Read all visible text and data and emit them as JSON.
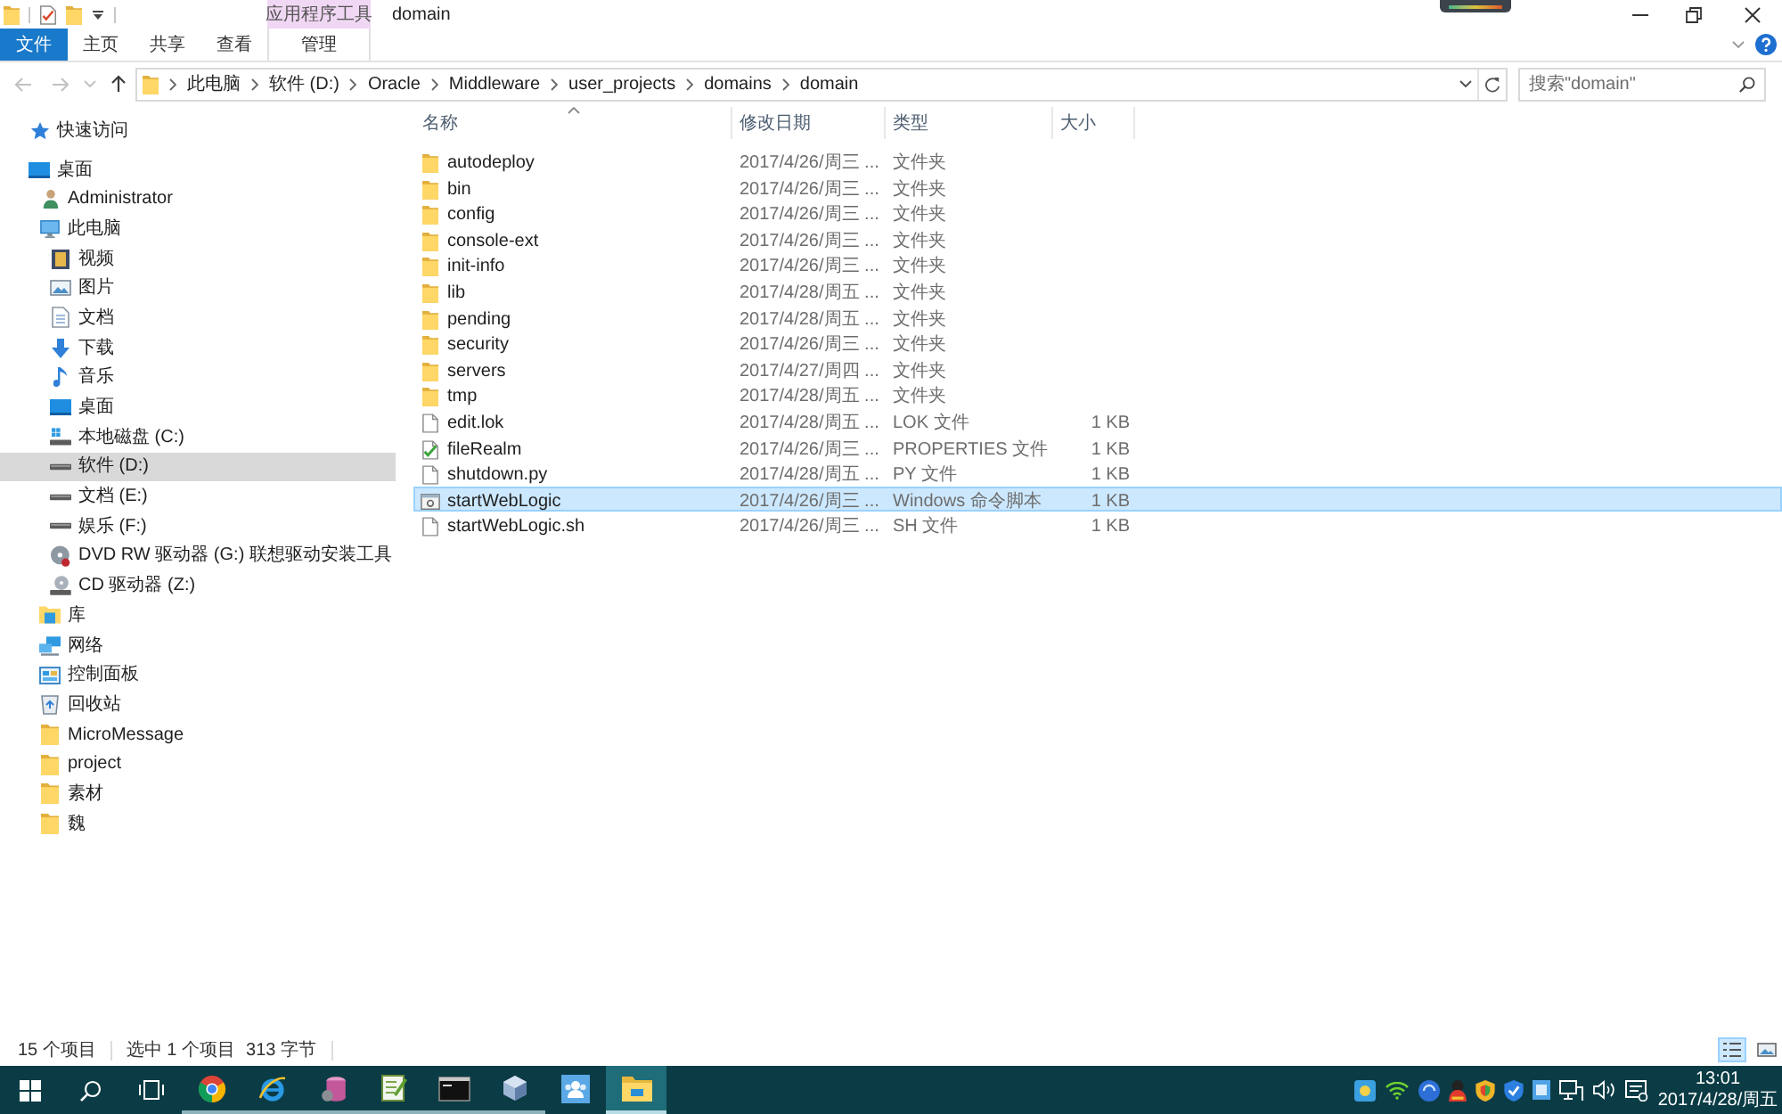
{
  "title_bar": {
    "title": "domain"
  },
  "ribbon": {
    "context_group": "应用程序工具",
    "tabs": [
      {
        "label": "文件",
        "kind": "file"
      },
      {
        "label": "主页",
        "kind": "standard"
      },
      {
        "label": "共享",
        "kind": "standard"
      },
      {
        "label": "查看",
        "kind": "standard"
      },
      {
        "label": "管理",
        "kind": "contextual"
      }
    ]
  },
  "navigation": [
    {
      "kind": "back",
      "disabled": true
    },
    {
      "kind": "forward",
      "disabled": true
    },
    {
      "kind": "recent",
      "disabled": true
    },
    {
      "kind": "up",
      "disabled": false
    }
  ],
  "address_bar": {
    "breadcrumbs": [
      "此电脑",
      "软件 (D:)",
      "Oracle",
      "Middleware",
      "user_projects",
      "domains",
      "domain"
    ]
  },
  "search": {
    "placeholder": "搜索\"domain\""
  },
  "sidebar": {
    "items": [
      {
        "label": "快速访问",
        "kind": "star",
        "selected": false
      },
      {
        "label": "桌面",
        "kind": "desktop",
        "selected": false,
        "children": [
          {
            "label": "Administrator",
            "kind": "user",
            "selected": false
          },
          {
            "label": "此电脑",
            "kind": "pc",
            "selected": false,
            "children": [
              {
                "label": "视频",
                "kind": "video",
                "selected": false
              },
              {
                "label": "图片",
                "kind": "picture",
                "selected": false
              },
              {
                "label": "文档",
                "kind": "document",
                "selected": false
              },
              {
                "label": "下载",
                "kind": "download",
                "selected": false
              },
              {
                "label": "音乐",
                "kind": "music",
                "selected": false
              },
              {
                "label": "桌面",
                "kind": "desktop",
                "selected": false
              },
              {
                "label": "本地磁盘 (C:)",
                "kind": "system-drive",
                "selected": false
              },
              {
                "label": "软件 (D:)",
                "kind": "drive",
                "selected": true
              },
              {
                "label": "文档 (E:)",
                "kind": "drive",
                "selected": false
              },
              {
                "label": "娱乐 (F:)",
                "kind": "drive",
                "selected": false
              },
              {
                "label": "DVD RW 驱动器 (G:) 联想驱动安装工具",
                "kind": "dvd",
                "selected": false
              },
              {
                "label": "CD 驱动器 (Z:)",
                "kind": "cd",
                "selected": false
              }
            ]
          },
          {
            "label": "库",
            "kind": "library",
            "selected": false
          },
          {
            "label": "网络",
            "kind": "network",
            "selected": false
          },
          {
            "label": "控制面板",
            "kind": "control-panel",
            "selected": false
          },
          {
            "label": "回收站",
            "kind": "recycle-bin",
            "selected": false
          },
          {
            "label": "MicroMessage",
            "kind": "folder",
            "selected": false
          },
          {
            "label": "project",
            "kind": "folder",
            "selected": false
          },
          {
            "label": "素材",
            "kind": "folder",
            "selected": false
          },
          {
            "label": "魏",
            "kind": "folder",
            "selected": false
          }
        ]
      }
    ]
  },
  "files": {
    "columns": [
      {
        "label": "名称",
        "sorted": true
      },
      {
        "label": "修改日期",
        "sorted": false
      },
      {
        "label": "类型",
        "sorted": false
      },
      {
        "label": "大小",
        "sorted": false
      }
    ],
    "rows": [
      {
        "name": "autodeploy",
        "kind": "folder",
        "date": "2017/4/26/周三 ...",
        "type": "文件夹",
        "selected": false
      },
      {
        "name": "bin",
        "kind": "folder",
        "date": "2017/4/26/周三 ...",
        "type": "文件夹",
        "selected": false
      },
      {
        "name": "config",
        "kind": "folder",
        "date": "2017/4/26/周三 ...",
        "type": "文件夹",
        "selected": false
      },
      {
        "name": "console-ext",
        "kind": "folder",
        "date": "2017/4/26/周三 ...",
        "type": "文件夹",
        "selected": false
      },
      {
        "name": "init-info",
        "kind": "folder",
        "date": "2017/4/26/周三 ...",
        "type": "文件夹",
        "selected": false
      },
      {
        "name": "lib",
        "kind": "folder",
        "date": "2017/4/28/周五 ...",
        "type": "文件夹",
        "selected": false
      },
      {
        "name": "pending",
        "kind": "folder",
        "date": "2017/4/28/周五 ...",
        "type": "文件夹",
        "selected": false
      },
      {
        "name": "security",
        "kind": "folder",
        "date": "2017/4/26/周三 ...",
        "type": "文件夹",
        "selected": false
      },
      {
        "name": "servers",
        "kind": "folder",
        "date": "2017/4/27/周四 ...",
        "type": "文件夹",
        "selected": false
      },
      {
        "name": "tmp",
        "kind": "folder",
        "date": "2017/4/28/周五 ...",
        "type": "文件夹",
        "selected": false
      },
      {
        "name": "edit.lok",
        "kind": "file",
        "date": "2017/4/28/周五 ...",
        "type": "LOK 文件",
        "size": "1 KB",
        "selected": false
      },
      {
        "name": "fileRealm",
        "kind": "checked-file",
        "date": "2017/4/26/周三 ...",
        "type": "PROPERTIES 文件",
        "size": "1 KB",
        "selected": false
      },
      {
        "name": "shutdown.py",
        "kind": "file",
        "date": "2017/4/28/周五 ...",
        "type": "PY 文件",
        "size": "1 KB",
        "selected": false
      },
      {
        "name": "startWebLogic",
        "kind": "script",
        "date": "2017/4/26/周三 ...",
        "type": "Windows 命令脚本",
        "size": "1 KB",
        "selected": true
      },
      {
        "name": "startWebLogic.sh",
        "kind": "file",
        "date": "2017/4/26/周三 ...",
        "type": "SH 文件",
        "size": "1 KB",
        "selected": false
      }
    ]
  },
  "status_bar": {
    "item_count": "15 个项目",
    "selection_count": "选中 1 个项目",
    "selection_size": "313 字节",
    "views": [
      {
        "kind": "details",
        "selected": true
      },
      {
        "kind": "large-icons",
        "selected": false
      }
    ]
  },
  "taskbar": {
    "apps": [
      {
        "kind": "chrome",
        "running": true,
        "active": false
      },
      {
        "kind": "ie",
        "running": true,
        "active": false
      },
      {
        "kind": "database",
        "running": true,
        "active": false
      },
      {
        "kind": "notepad",
        "running": true,
        "active": false
      },
      {
        "kind": "terminal",
        "running": true,
        "active": false
      },
      {
        "kind": "cube",
        "running": true,
        "active": false
      },
      {
        "kind": "people",
        "running": false,
        "active": false
      },
      {
        "kind": "explorer",
        "running": true,
        "active": true
      }
    ],
    "clock": {
      "time": "13:01",
      "date": "2017/4/28/周五"
    }
  }
}
